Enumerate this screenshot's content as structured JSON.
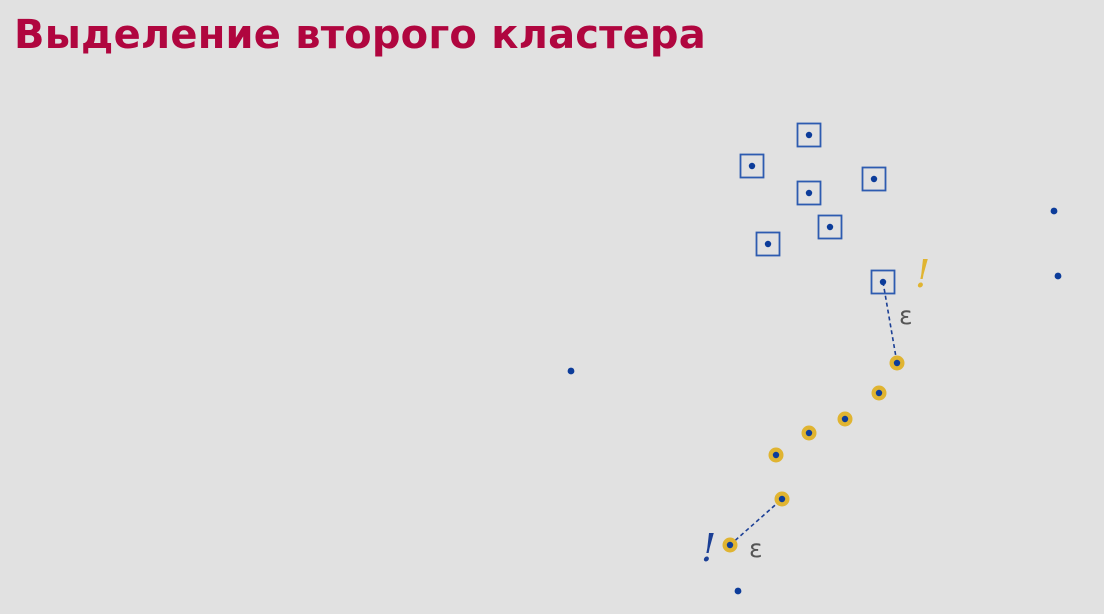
{
  "slide": {
    "title": "Выделение второго кластера",
    "colors": {
      "background": "#e1e1e1",
      "title": "#b0063f",
      "point": "#0c3c9a",
      "core_marker": "#2d5bb0",
      "border_ring": "#e0b431",
      "epsilon_line": "#1b3f95",
      "epsilon_text": "#555555",
      "warning_yellow": "#e0b431",
      "warning_blue": "#1b3f95"
    }
  },
  "diagram": {
    "epsilon_symbol": "ε",
    "warning_symbol": "!"
  }
}
